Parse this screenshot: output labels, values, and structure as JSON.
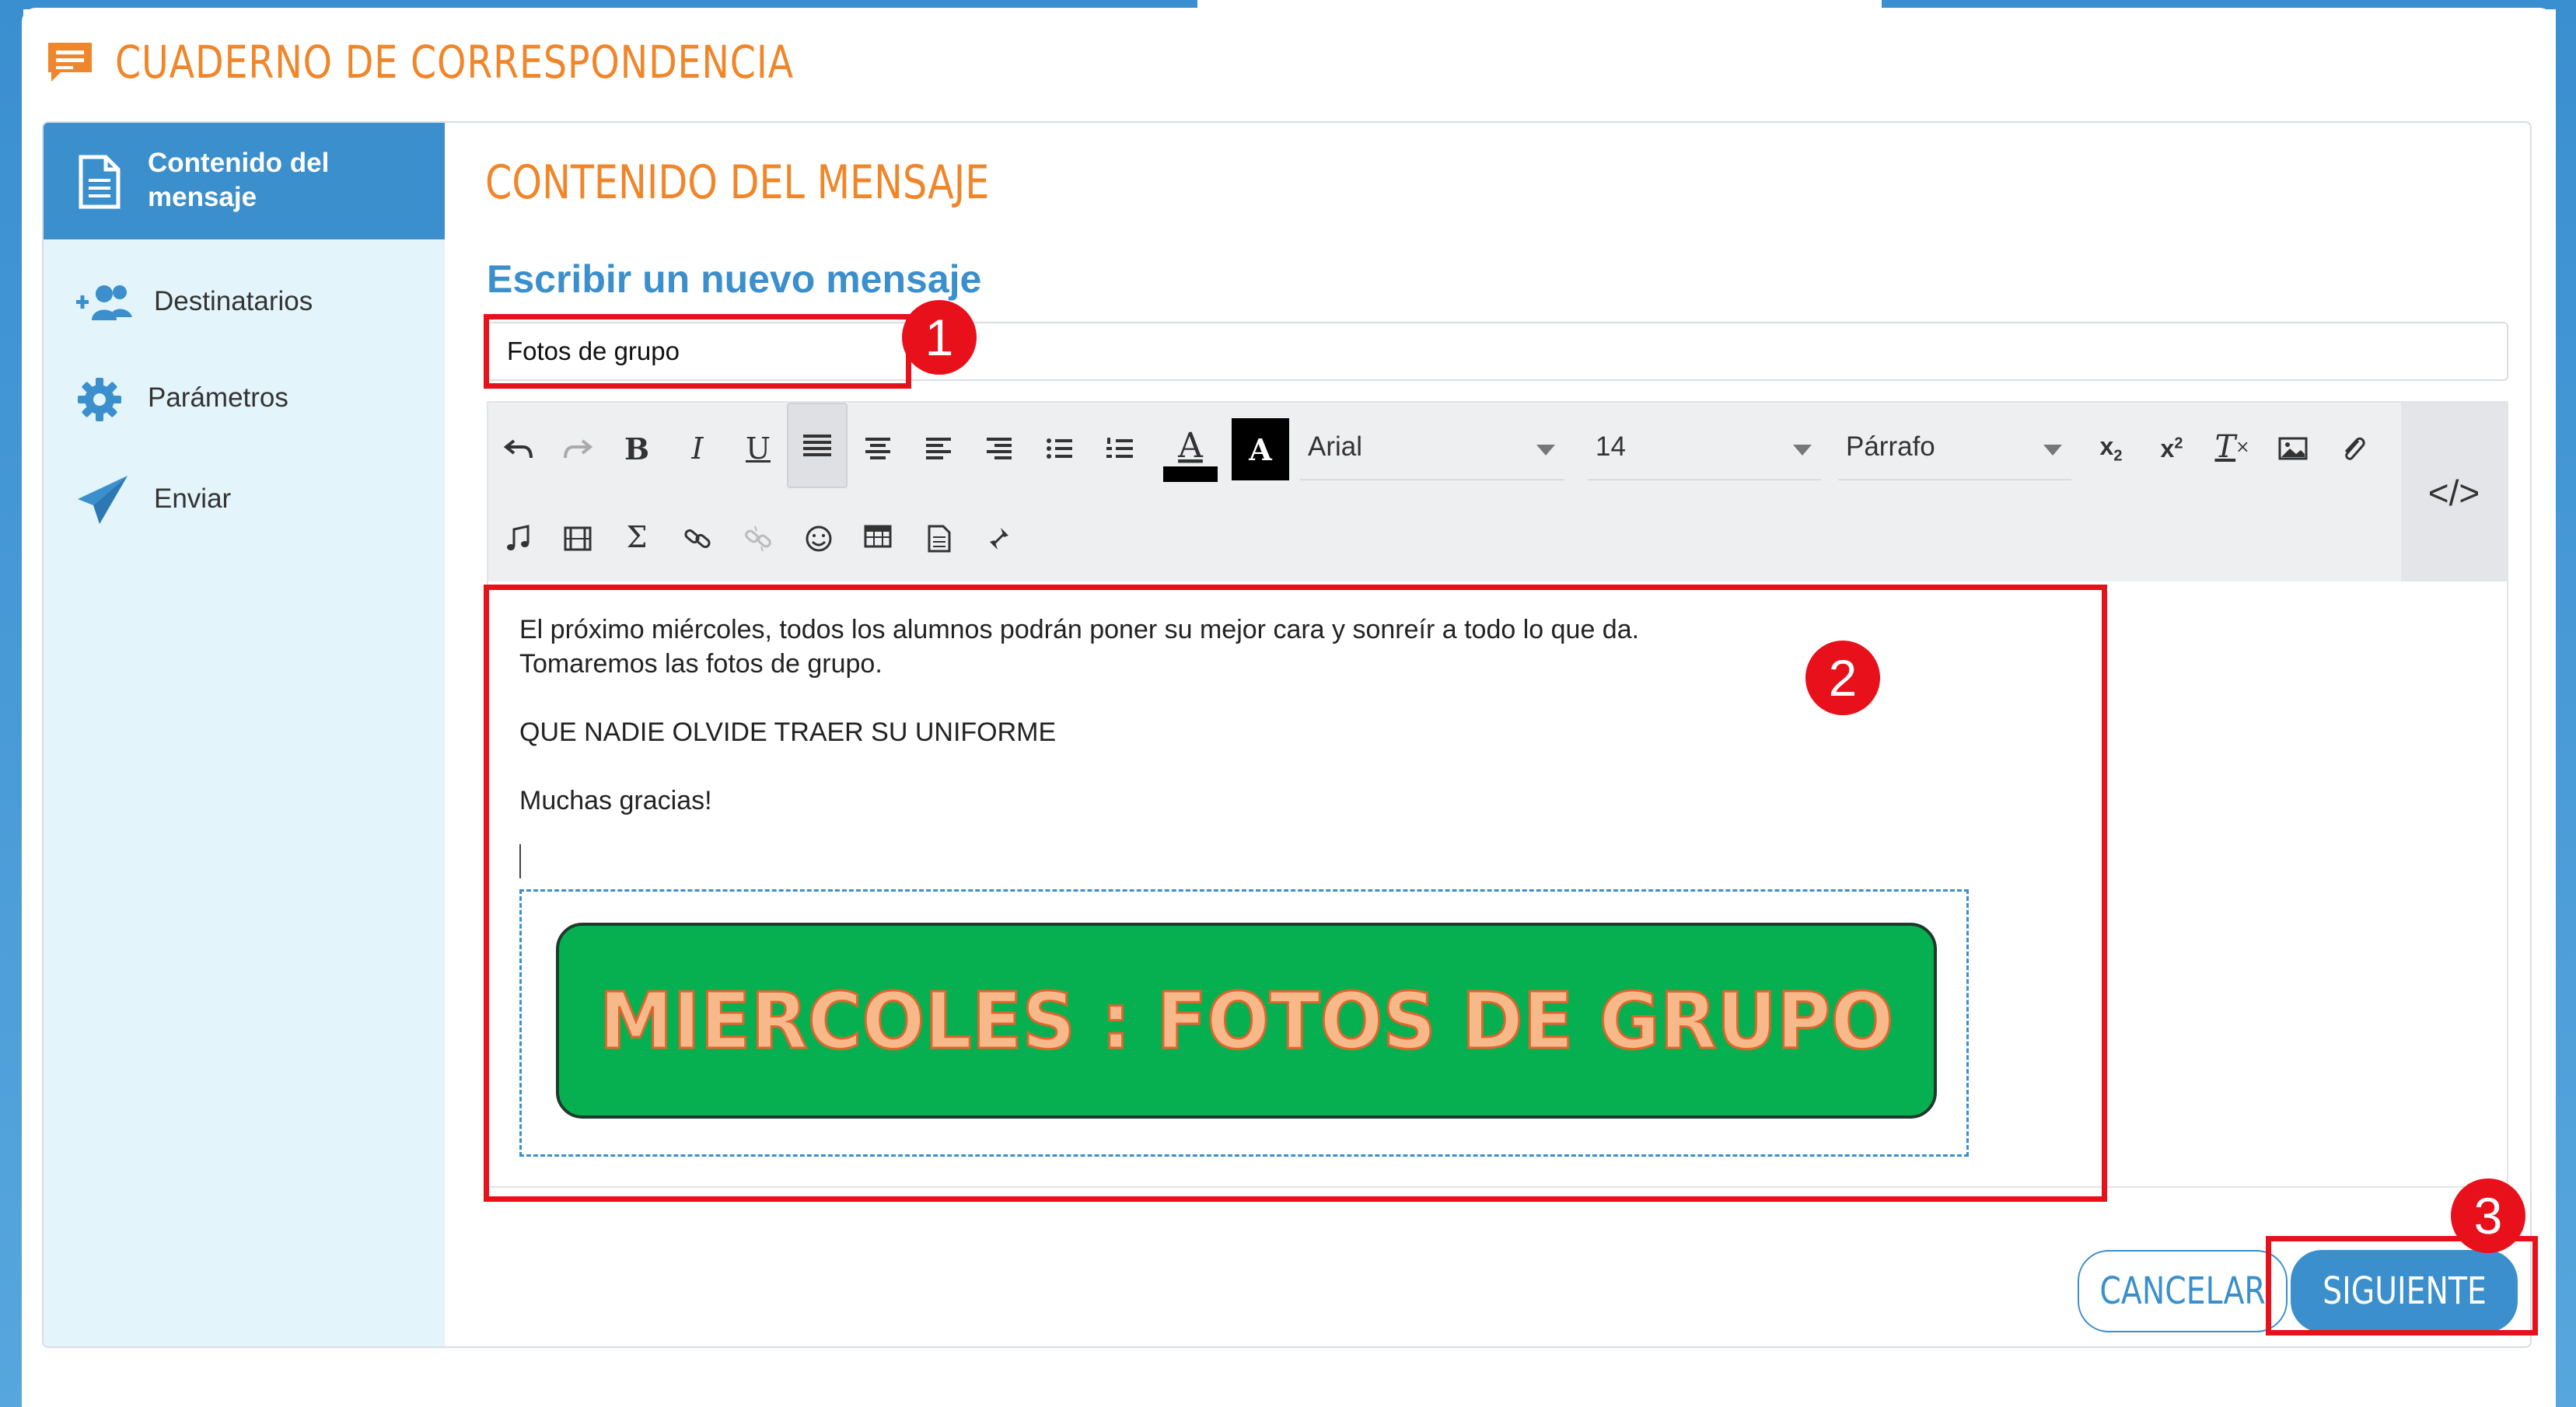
{
  "app": {
    "title": "CUADERNO DE CORRESPONDENCIA"
  },
  "sidebar": {
    "items": [
      {
        "label": "Contenido del mensaje",
        "icon": "document-icon",
        "active": true
      },
      {
        "label": "Destinatarios",
        "icon": "users-add-icon",
        "active": false
      },
      {
        "label": "Parámetros",
        "icon": "gear-icon",
        "active": false
      },
      {
        "label": "Enviar",
        "icon": "paper-plane-icon",
        "active": false
      }
    ]
  },
  "main": {
    "section_title": "CONTENIDO DEL MENSAJE",
    "subheading": "Escribir un nuevo mensaje",
    "subject_value": "Fotos de grupo"
  },
  "toolbar": {
    "font_family": "Arial",
    "font_size": "14",
    "block_format": "Párrafo"
  },
  "editor": {
    "lines": [
      "El próximo miércoles, todos los alumnos podrán poner su mejor cara y sonreír a todo lo que da.",
      "Tomaremos las fotos de grupo.",
      "",
      "QUE NADIE OLVIDE TRAER SU UNIFORME",
      "",
      "Muchas gracias!"
    ],
    "banner_text": "MIERCOLES : FOTOS DE GRUPO"
  },
  "actions": {
    "cancel_label": "CANCELAR",
    "next_label": "SIGUIENTE"
  },
  "annotations": {
    "markers": [
      "1",
      "2",
      "3"
    ]
  },
  "colors": {
    "accent_orange": "#f0862a",
    "primary_blue": "#3a8fcc",
    "sidebar_bg": "#e3f4fa",
    "banner_green": "#06b050",
    "highlight_red": "#e8101a"
  }
}
